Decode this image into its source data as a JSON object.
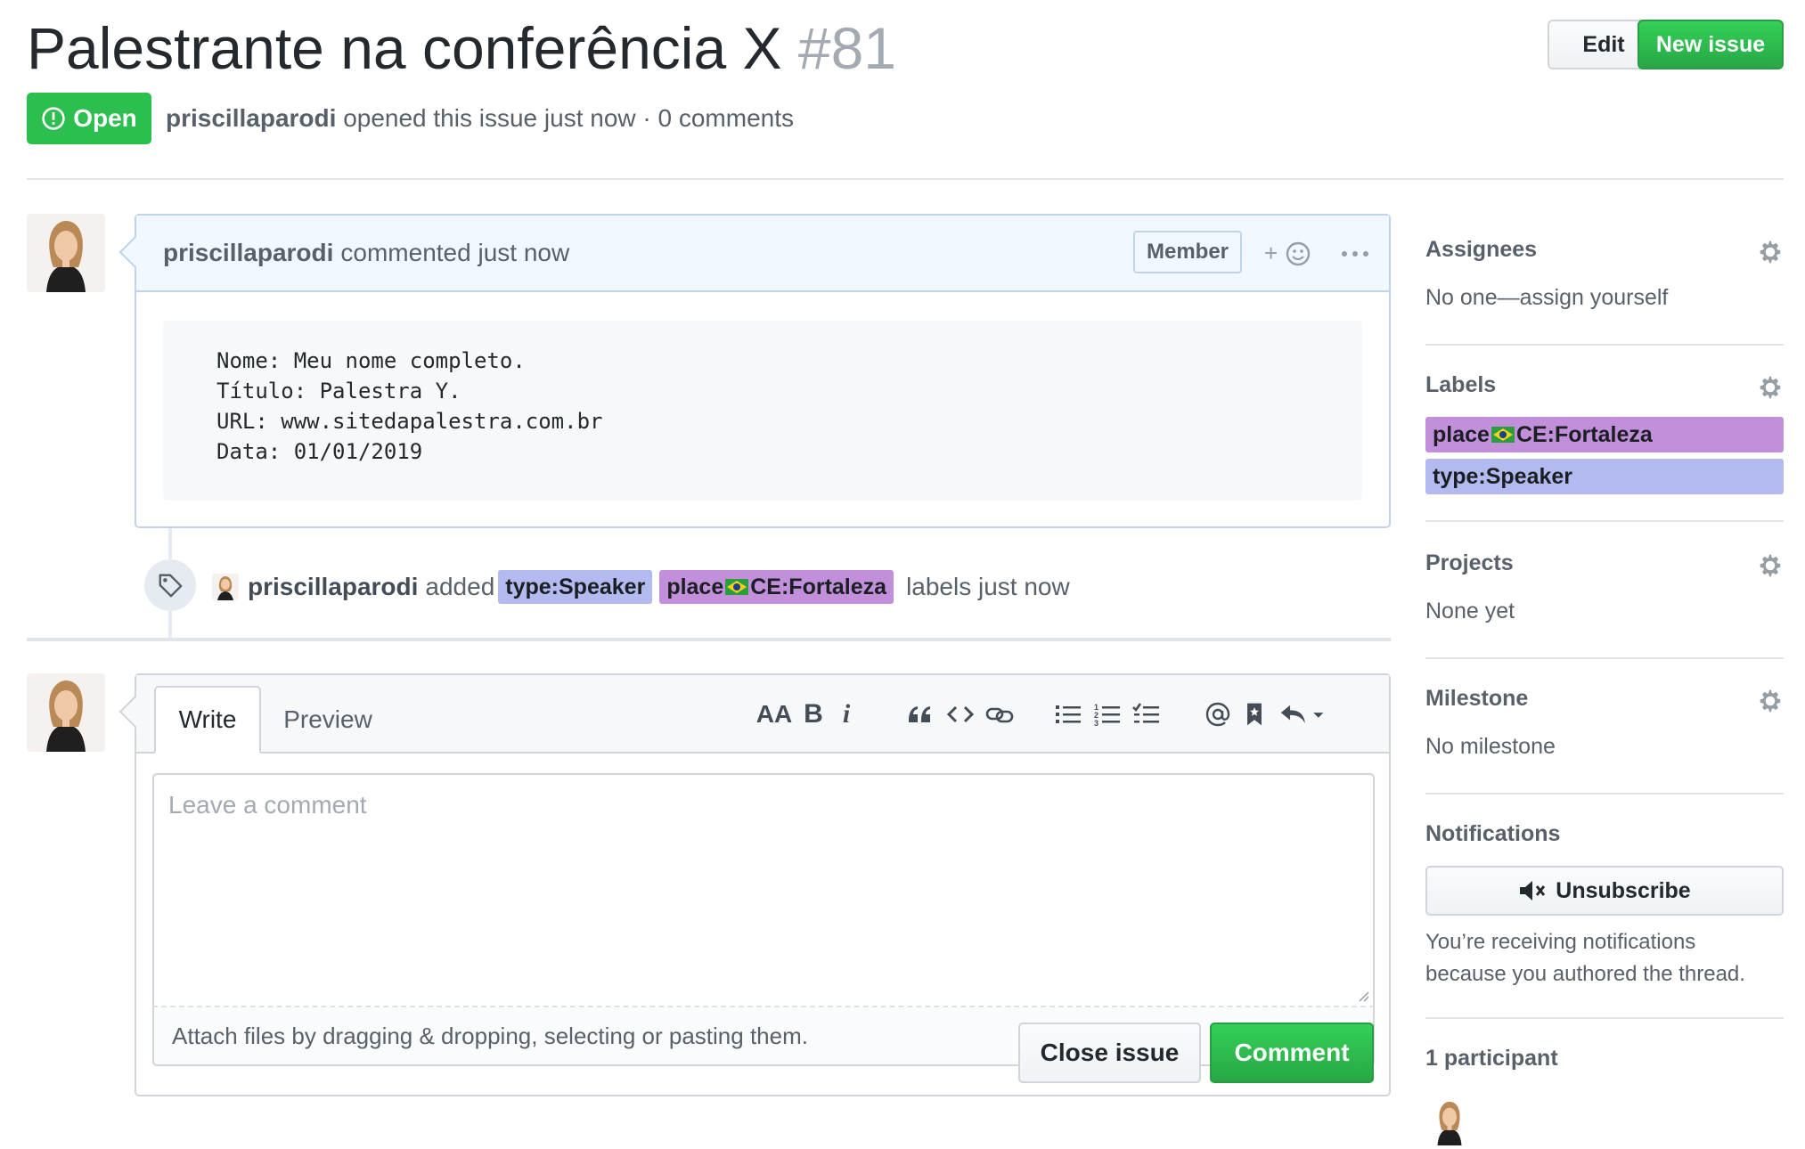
{
  "issue": {
    "title": "Palestrante na conferência X",
    "number": "#81",
    "state": "Open",
    "author": "priscillaparodi",
    "meta_text": "opened this issue just now · 0 comments"
  },
  "header_buttons": {
    "edit": "Edit",
    "new_issue": "New issue"
  },
  "comment": {
    "author": "priscillaparodi",
    "action": "commented just now",
    "badge": "Member",
    "reaction_plus": "+",
    "body_lines": [
      "Nome: Meu nome completo.",
      "Título: Palestra Y.",
      "URL: www.sitedapalestra.com.br",
      "Data: 01/01/2019"
    ]
  },
  "event": {
    "actor": "priscillaparodi",
    "verb": "added",
    "labels": [
      {
        "name_prefix": "type:Speaker",
        "name_suffix": "",
        "color": "#b3baf0"
      },
      {
        "name_prefix": "place",
        "name_suffix": "CE:Fortaleza",
        "color": "#c28fdb"
      }
    ],
    "tail": "labels just now"
  },
  "composer": {
    "tab_write": "Write",
    "tab_preview": "Preview",
    "placeholder": "Leave a comment",
    "attach_text": "Attach files by dragging & dropping, selecting or pasting them.",
    "toolbar": {
      "heading": "AA",
      "bold": "B",
      "italic": "i"
    },
    "close_button": "Close issue",
    "comment_button": "Comment"
  },
  "sidebar": {
    "assignees": {
      "title": "Assignees",
      "text": "No one—assign yourself"
    },
    "labels": {
      "title": "Labels",
      "items": [
        {
          "prefix": "place",
          "suffix": "CE:Fortaleza",
          "color": "#c28fdb"
        },
        {
          "prefix": "type:Speaker",
          "suffix": "",
          "color": "#b3baf0"
        }
      ]
    },
    "projects": {
      "title": "Projects",
      "text": "None yet"
    },
    "milestone": {
      "title": "Milestone",
      "text": "No milestone"
    },
    "notifications": {
      "title": "Notifications",
      "button": "Unsubscribe",
      "text_line1": "You’re receiving notifications",
      "text_line2": "because you authored the thread."
    },
    "participants": {
      "title": "1 participant"
    }
  },
  "colors": {
    "green": "#2cbe4e",
    "comment_header_bg": "#f1f8ff",
    "comment_border": "#c0d3eb"
  }
}
